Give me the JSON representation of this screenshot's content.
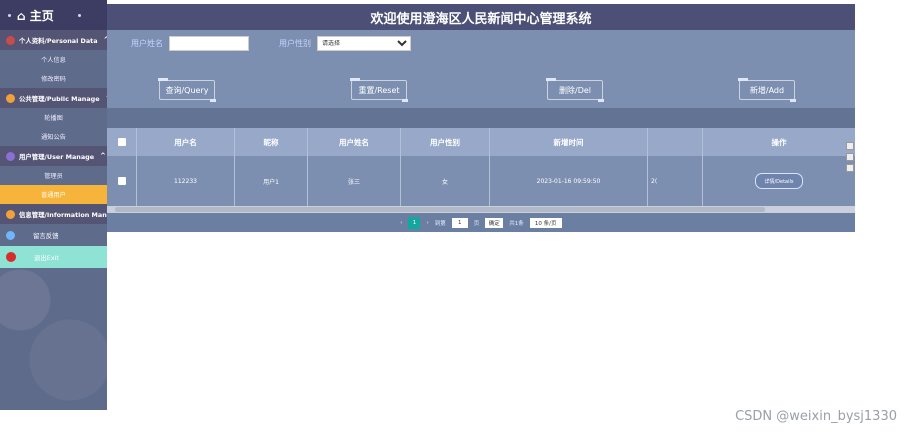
{
  "header": {
    "title": "欢迎使用澄海区人民新闻中心管理系统"
  },
  "sidebar": {
    "home": "主页",
    "groups": [
      {
        "label": "个人资料/Personal Data",
        "items": [
          "个人信息",
          "修改密码"
        ]
      },
      {
        "label": "公共管理/Public Manage",
        "items": [
          "轮播图",
          "通知公告"
        ]
      },
      {
        "label": "用户管理/User Manage",
        "items": [
          "管理员",
          "普通用户"
        ]
      },
      {
        "label": "信息管理/Information Manage",
        "items": []
      }
    ],
    "feedback": "留言反馈",
    "logout": "退出Exit",
    "active_item": "普通用户"
  },
  "search": {
    "name_label": "用户姓名",
    "name_value": "",
    "gender_label": "用户性别",
    "gender_placeholder": "请选择"
  },
  "toolbar": {
    "query": "查询/Query",
    "reset": "重置/Reset",
    "delete": "删除/Del",
    "add": "新增/Add"
  },
  "table": {
    "columns": [
      "用户名",
      "昵称",
      "用户姓名",
      "用户性别",
      "新增时间",
      "",
      "操作"
    ],
    "rows": [
      {
        "username": "112233",
        "nickname": "用户1",
        "realname": "张三",
        "gender": "女",
        "created": "2023-01-16 09:59:50",
        "extra": "2(",
        "action": "详情/Details"
      }
    ]
  },
  "pager": {
    "prev": "‹",
    "current": "1",
    "next": "›",
    "goto_label": "到第",
    "page_input": "1",
    "page_unit": "页",
    "confirm": "确定",
    "total": "共1条",
    "page_size": "10 条/页"
  },
  "watermark": "CSDN @weixin_bysj1330",
  "colors": {
    "sidebar": "#5f6b8b",
    "topbar": "#4c4f76",
    "main": "#7c8fb1",
    "active": "#f6b53a",
    "logout": "#8ee3d4"
  }
}
